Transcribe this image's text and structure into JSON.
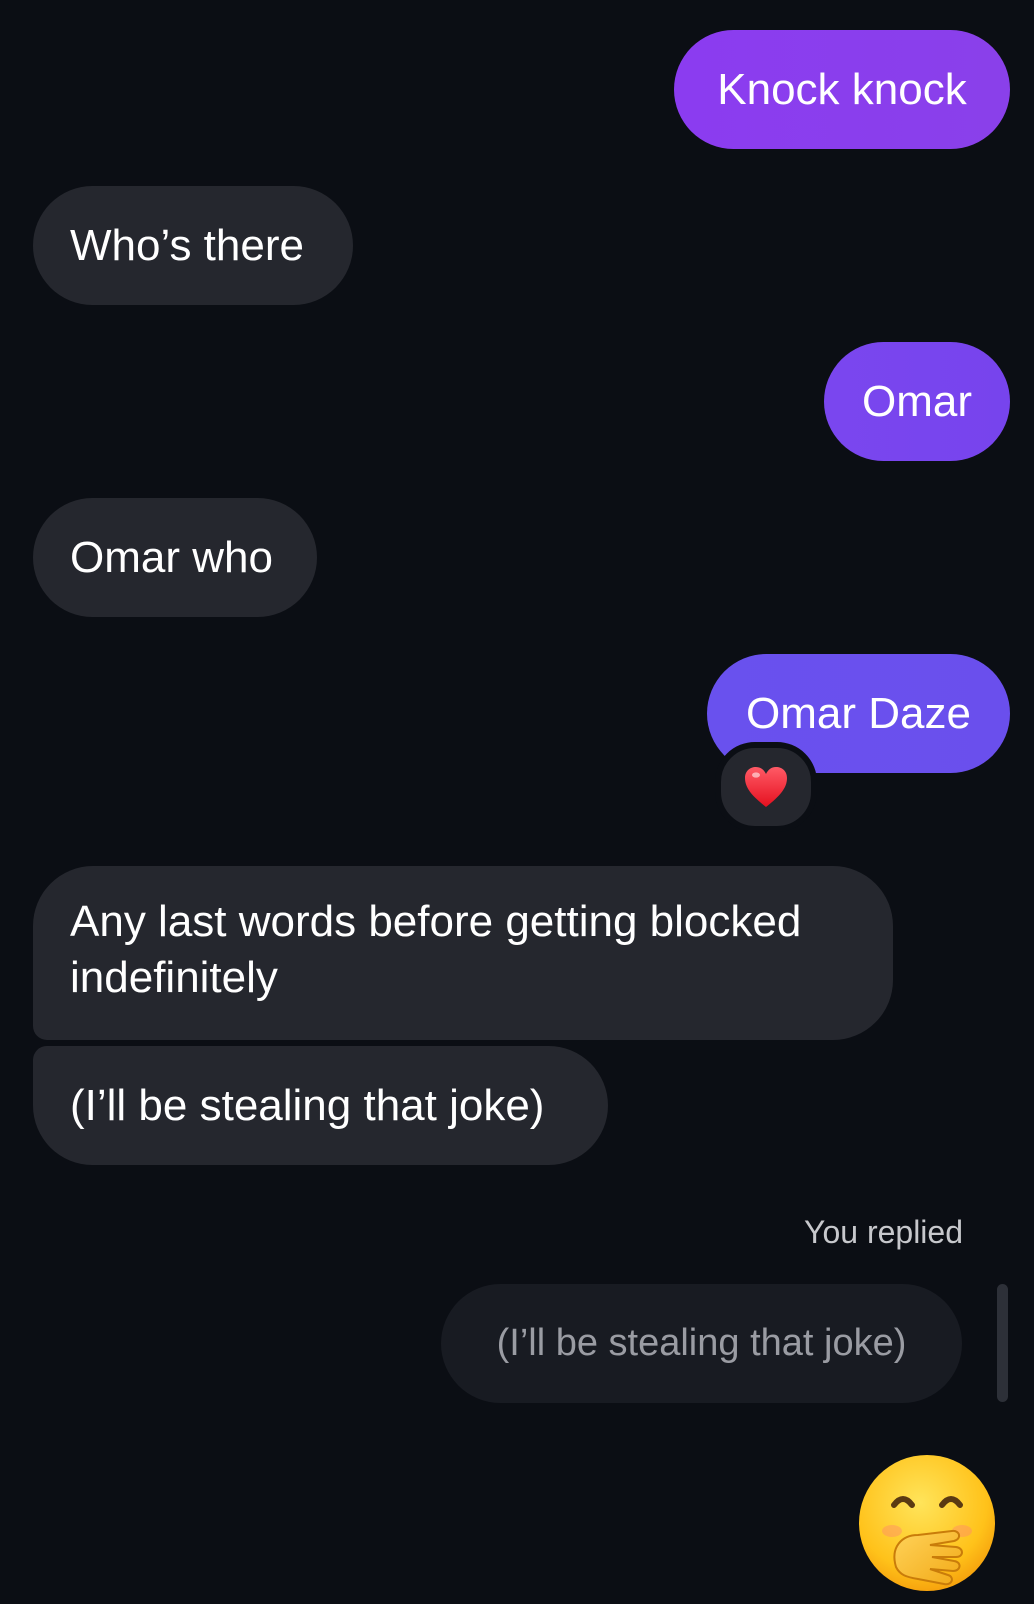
{
  "messages": [
    {
      "id": "msg1",
      "text": "Knock knock",
      "direction": "outgoing"
    },
    {
      "id": "msg2",
      "text": "Who’s there",
      "direction": "incoming"
    },
    {
      "id": "msg3",
      "text": "Omar",
      "direction": "outgoing"
    },
    {
      "id": "msg4",
      "text": "Omar who",
      "direction": "incoming"
    },
    {
      "id": "msg5",
      "text": "Omar Daze",
      "direction": "outgoing",
      "reaction": "heart"
    },
    {
      "id": "msg6",
      "text_line1": "Any last words before getting blocked",
      "text_line2": "indefinitely",
      "direction": "incoming"
    },
    {
      "id": "msg7",
      "text": "(I’ll be stealing that joke)",
      "direction": "incoming"
    }
  ],
  "reply": {
    "label": "You replied",
    "quoted_text": "(I’ll be stealing that joke)",
    "emoji": "face-with-hand-over-mouth"
  },
  "colors": {
    "background": "#0b0e14",
    "incoming_bubble": "#25272e",
    "outgoing_top": "#8b3cf0",
    "outgoing_bottom": "#6951ee",
    "heart": "#ff2d3d"
  }
}
